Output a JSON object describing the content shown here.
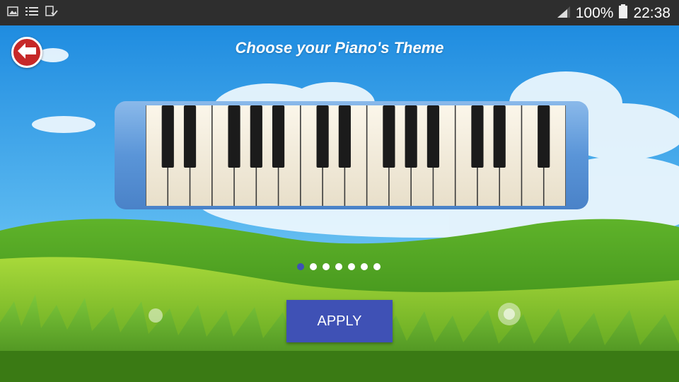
{
  "status_bar": {
    "battery": "100%",
    "time": "22:38",
    "left_icons": [
      "image-icon",
      "list-icon",
      "sync-icon"
    ]
  },
  "header": {
    "title": "Choose your Piano's Theme",
    "back_icon": "arrow-left-icon"
  },
  "carousel": {
    "page_count": 7,
    "active_index": 0
  },
  "apply_button": {
    "label": "APPLY"
  },
  "colors": {
    "accent": "#3f51b5",
    "back_button": "#c62828",
    "status_bar": "#2e2e2e",
    "piano_body": "#5a95d8"
  }
}
